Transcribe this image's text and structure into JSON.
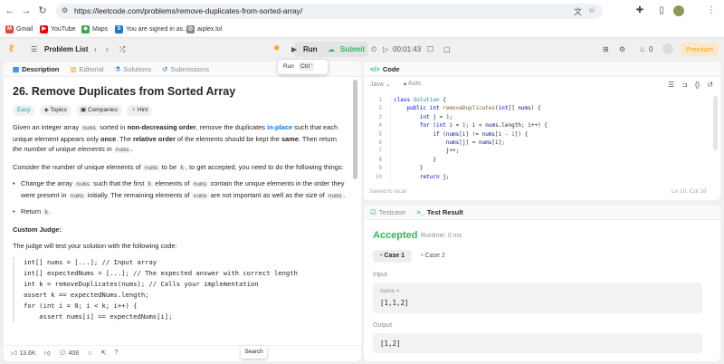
{
  "browser": {
    "url": "https://leetcode.com/problems/remove-duplicates-from-sorted-array/",
    "bookmarks": [
      {
        "label": "Gmail",
        "color": "#ea4335",
        "glyph": "M"
      },
      {
        "label": "YouTube",
        "color": "#ff0000",
        "glyph": "▶"
      },
      {
        "label": "Maps",
        "color": "#34a853",
        "glyph": "◆"
      },
      {
        "label": "You are signed in as...",
        "color": "#1976d2",
        "glyph": "S"
      },
      {
        "label": "aiplex.lol",
        "color": "#888888",
        "glyph": "◎"
      }
    ]
  },
  "topbar": {
    "problem_list": "Problem List",
    "run": "Run",
    "submit": "Submit",
    "timer": "00:01:43",
    "notifications": "0",
    "premium": "Premium",
    "tooltip_label": "Run",
    "tooltip_key": "Ctrl '"
  },
  "left": {
    "tabs": [
      "Description",
      "Editorial",
      "Solutions",
      "Submissions"
    ],
    "title": "26. Remove Duplicates from Sorted Array",
    "chips": [
      "Easy",
      "Topics",
      "Companies",
      "Hint"
    ],
    "p1": {
      "a": "Given an integer array ",
      "c1": "nums",
      "b": " sorted in ",
      "s1": "non-decreasing order",
      "c": ", remove the duplicates ",
      "s2": "in-place",
      "d": " such that each unique element appears only ",
      "s3": "once",
      "e": ". The ",
      "s4": "relative order",
      "f": " of the elements should be kept the ",
      "s5": "same",
      "g": ". Then return ",
      "i1": "the number of unique elements in",
      "c2": "nums",
      "h": "."
    },
    "p2": {
      "a": "Consider the number of unique elements of ",
      "c1": "nums",
      "b": " to be ",
      "c2": "k",
      "c": ", to get accepted, you need to do the following things:"
    },
    "b1": {
      "a": "Change the array ",
      "c1": "nums",
      "b": " such that the first ",
      "c2": "k",
      "c": " elements of ",
      "c3": "nums",
      "d": " contain the unique elements in the order they were present in ",
      "c4": "nums",
      "e": " initially. The remaining elements of ",
      "c5": "nums",
      "f": " are not important as well as the size of ",
      "c6": "nums",
      "g": "."
    },
    "b2": {
      "a": "Return ",
      "c1": "k",
      "b": "."
    },
    "judge_heading": "Custom Judge:",
    "judge_text": "The judge will test your solution with the following code:",
    "judge_code": [
      "int[] nums = [...]; // Input array",
      "int[] expectedNums = [...]; // The expected answer with correct length",
      "",
      "int k = removeDuplicates(nums); // Calls your implementation",
      "",
      "assert k == expectedNums.length;",
      "for (int i = 0; i < k; i++) {",
      "    assert nums[i] == expectedNums[i];"
    ],
    "likes": "13.6K",
    "comments": "408",
    "search_tooltip": "Search"
  },
  "editor": {
    "tab": "Code",
    "language": "Java",
    "mode": "Auto",
    "lines": [
      [
        [
          "kw",
          "class "
        ],
        [
          "ty",
          "Solution "
        ],
        [
          "",
          "{"
        ]
      ],
      [
        [
          "",
          "    "
        ],
        [
          "kw",
          "public int "
        ],
        [
          "fn",
          "removeDuplicates"
        ],
        [
          "",
          "("
        ],
        [
          "kw",
          "int"
        ],
        [
          "",
          "[] "
        ],
        [
          "vr",
          "nums"
        ],
        [
          "",
          ") {"
        ]
      ],
      [
        [
          "",
          "        "
        ],
        [
          "kw",
          "int "
        ],
        [
          "vr",
          "j"
        ],
        [
          "",
          " = "
        ],
        [
          "nm",
          "1"
        ],
        [
          "",
          ";"
        ]
      ],
      [
        [
          "",
          "        "
        ],
        [
          "kw",
          "for "
        ],
        [
          "",
          "("
        ],
        [
          "kw",
          "int "
        ],
        [
          "vr",
          "i"
        ],
        [
          "",
          " = "
        ],
        [
          "nm",
          "1"
        ],
        [
          "",
          "; "
        ],
        [
          "vr",
          "i"
        ],
        [
          "",
          " < "
        ],
        [
          "vr",
          "nums"
        ],
        [
          "",
          ".length; "
        ],
        [
          "vr",
          "i"
        ],
        [
          "",
          "++) {"
        ]
      ],
      [
        [
          "",
          "            "
        ],
        [
          "kw",
          "if "
        ],
        [
          "",
          "("
        ],
        [
          "vr",
          "nums"
        ],
        [
          "",
          "["
        ],
        [
          "vr",
          "i"
        ],
        [
          "",
          "] != "
        ],
        [
          "vr",
          "nums"
        ],
        [
          "",
          "["
        ],
        [
          "vr",
          "i"
        ],
        [
          "",
          " - "
        ],
        [
          "nm",
          "1"
        ],
        [
          "",
          "]) {"
        ]
      ],
      [
        [
          "",
          "                "
        ],
        [
          "vr",
          "nums"
        ],
        [
          "",
          "["
        ],
        [
          "vr",
          "j"
        ],
        [
          "",
          "] = "
        ],
        [
          "vr",
          "nums"
        ],
        [
          "",
          "["
        ],
        [
          "vr",
          "i"
        ],
        [
          "",
          "];"
        ]
      ],
      [
        [
          "",
          "                "
        ],
        [
          "vr",
          "j"
        ],
        [
          "",
          "++;"
        ]
      ],
      [
        [
          "",
          "            }"
        ]
      ],
      [
        [
          "",
          "        }"
        ]
      ],
      [
        [
          "",
          "        "
        ],
        [
          "kw",
          "return "
        ],
        [
          "vr",
          "j"
        ],
        [
          "",
          ";"
        ]
      ]
    ],
    "saved": "Saved to local",
    "position": "Ln 10, Col 18"
  },
  "result": {
    "tabs": [
      "Testcase",
      "Test Result"
    ],
    "status": "Accepted",
    "runtime": "Runtime: 0 ms",
    "cases": [
      "Case 1",
      "Case 2"
    ],
    "input_label": "Input",
    "var_name": "nums =",
    "input_value": "[1,1,2]",
    "output_label": "Output",
    "output_value": "[1,2]"
  },
  "colors": {
    "accepted": "#2cbb5d",
    "easy": "#00af9b",
    "premium": "#ffa116",
    "link": "#007aff"
  }
}
